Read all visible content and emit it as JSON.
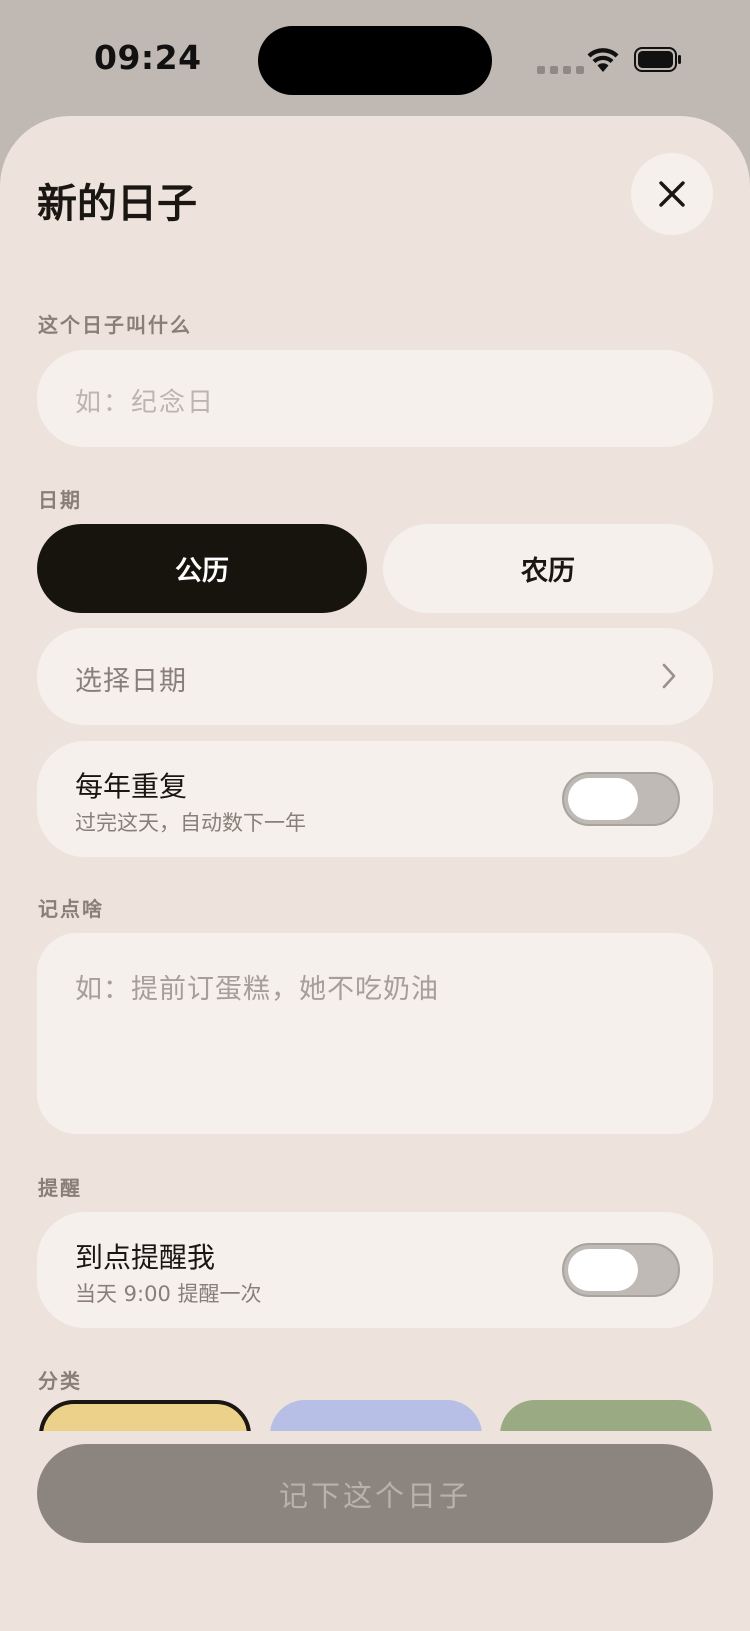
{
  "status_bar": {
    "time": "09:24"
  },
  "sheet": {
    "title": "新的日子",
    "close_icon": "close-icon"
  },
  "name_field": {
    "label": "这个日子叫什么",
    "placeholder": "如：纪念日"
  },
  "date": {
    "label": "日期",
    "calendar_options": [
      "公历",
      "农历"
    ],
    "selected_calendar": "公历",
    "picker_text": "选择日期"
  },
  "repeat": {
    "title": "每年重复",
    "subtitle": "过完这天，自动数下一年",
    "enabled": false
  },
  "note": {
    "label": "记点啥",
    "placeholder": "如：提前订蛋糕，她不吃奶油"
  },
  "reminder": {
    "label": "提醒",
    "title": "到点提醒我",
    "subtitle": "当天 9:00 提醒一次",
    "enabled": false
  },
  "category": {
    "label": "分类",
    "colors": [
      "#ecd18a",
      "#b7bfe6",
      "#9aab84"
    ],
    "selected_index": 0
  },
  "submit": {
    "label": "记下这个日子"
  },
  "colors": {
    "sheet_bg": "#ede3dc",
    "field_bg": "#f5f0ec",
    "primary_dark": "#17130d",
    "submit_disabled": "#8c857f"
  }
}
